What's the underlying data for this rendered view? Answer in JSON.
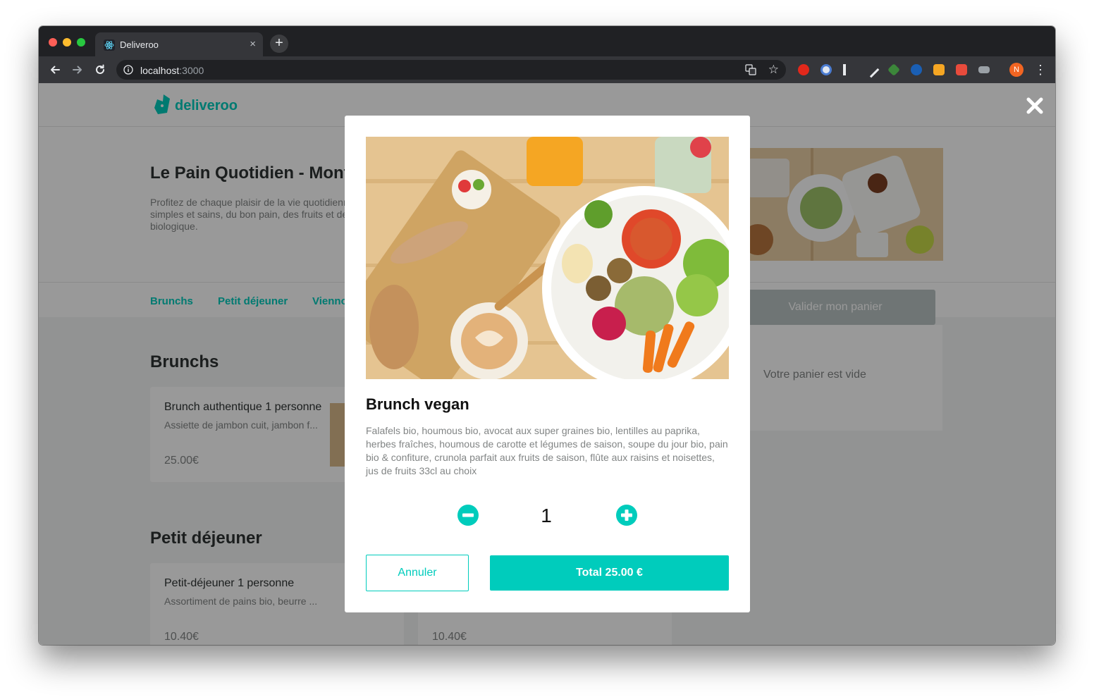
{
  "browser": {
    "tab_title": "Deliveroo",
    "tab_close": "×",
    "new_tab": "+",
    "url_host": "localhost",
    "url_port": ":3000",
    "star": "☆",
    "profile_initial": "N",
    "menu": "⋮"
  },
  "site": {
    "logo_text": "deliveroo",
    "brand_color": "#00ccbc"
  },
  "restaurant": {
    "name": "Le Pain Quotidien - Montorgueil",
    "description": "Profitez de chaque plaisir de la vie quotidienne. Le Pain Quotidien propose des ingrédients simples et sains, du bon pain, des fruits et des légumes frais et de saison issus de l’agriculture biologique."
  },
  "categories": [
    "Brunchs",
    "Petit déjeuner",
    "Viennoiseries"
  ],
  "sections": [
    {
      "title": "Brunchs",
      "items": [
        {
          "title": "Brunch authentique 1 personne",
          "description": "Assiette de jambon cuit, jambon f...",
          "price": "25.00€"
        }
      ]
    },
    {
      "title": "Petit déjeuner",
      "items": [
        {
          "title": "Petit-déjeuner 1 personne",
          "description": "Assortiment de pains bio, beurre ...",
          "price": "10.40€"
        },
        {
          "title": "",
          "description": "",
          "price": "10.40€"
        }
      ]
    }
  ],
  "cart": {
    "validate_label": "Valider mon panier",
    "empty_label": "Votre panier est vide"
  },
  "modal": {
    "title": "Brunch vegan",
    "description": "Falafels bio, houmous bio, avocat aux super graines bio, lentilles au paprika, herbes fraîches, houmous de carotte et légumes de saison, soupe du jour bio, pain bio & confiture, crunola parfait aux fruits de saison, flûte aux raisins et noisettes, jus de fruits 33cl au choix",
    "quantity": "1",
    "cancel_label": "Annuler",
    "total_label": "Total 25.00 €"
  }
}
